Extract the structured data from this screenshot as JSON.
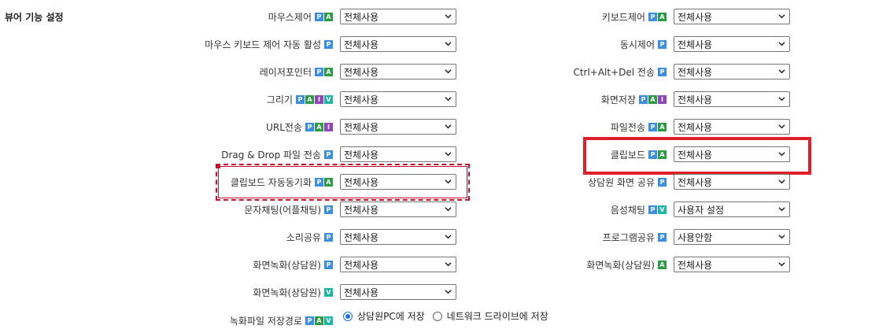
{
  "section_title": "뷰어 기능 설정",
  "left": [
    {
      "label": "마우스제어",
      "badges": [
        "P",
        "A"
      ],
      "value": "전체사용"
    },
    {
      "label": "마우스 키보드 제어 자동 활성",
      "badges": [
        "P"
      ],
      "value": "전체사용"
    },
    {
      "label": "레이저포인터",
      "badges": [
        "P",
        "A"
      ],
      "value": "전체사용"
    },
    {
      "label": "그리기",
      "badges": [
        "P",
        "A",
        "I",
        "V"
      ],
      "value": "전체사용"
    },
    {
      "label": "URL전송",
      "badges": [
        "P",
        "A",
        "I"
      ],
      "value": "전체사용"
    },
    {
      "label": "Drag & Drop 파일 전송",
      "badges": [
        "P"
      ],
      "value": "전체사용"
    },
    {
      "label": "클립보드 자동동기화",
      "badges": [
        "P",
        "A"
      ],
      "value": "전체사용"
    },
    {
      "label": "문자채팅(어플채팅)",
      "badges": [
        "P"
      ],
      "value": "전체사용"
    },
    {
      "label": "소리공유",
      "badges": [
        "P"
      ],
      "value": "전체사용"
    },
    {
      "label": "화면녹화(상담원)",
      "badges": [
        "P"
      ],
      "value": "전체사용"
    },
    {
      "label": "화면녹화(상담원)",
      "badges": [
        "V"
      ],
      "value": "전체사용"
    }
  ],
  "left_last": {
    "label": "녹화파일 저장경로",
    "badges": [
      "P",
      "A",
      "V"
    ],
    "options": [
      {
        "label": "상담원PC에 저장",
        "selected": true
      },
      {
        "label": "네트워크 드라이브에 저장",
        "selected": false
      }
    ]
  },
  "right": [
    {
      "label": "키보드제어",
      "badges": [
        "P",
        "A"
      ],
      "value": "전체사용"
    },
    {
      "label": "동시제어",
      "badges": [
        "P"
      ],
      "value": "전체사용"
    },
    {
      "label": "Ctrl+Alt+Del 전송",
      "badges": [
        "P"
      ],
      "value": "전체사용"
    },
    {
      "label": "화면저장",
      "badges": [
        "P",
        "A",
        "I"
      ],
      "value": "전체사용"
    },
    {
      "label": "파일전송",
      "badges": [
        "P",
        "A"
      ],
      "value": "전체사용"
    },
    {
      "label": "클립보드",
      "badges": [
        "P",
        "A"
      ],
      "value": "전체사용"
    },
    {
      "label": "상담원 화면 공유",
      "badges": [
        "P"
      ],
      "value": "전체사용"
    },
    {
      "label": "음성채팅",
      "badges": [
        "P",
        "V"
      ],
      "value": "사용자 설정"
    },
    {
      "label": "프로그램공유",
      "badges": [
        "P"
      ],
      "value": "사용안함"
    },
    {
      "label": "화면녹화(상담원)",
      "badges": [
        "A"
      ],
      "value": "전체사용"
    }
  ],
  "badge_colors": {
    "P": "#3c8fe0",
    "A": "#2f9a46",
    "I": "#8e47b8",
    "V": "#1fb5a3"
  },
  "icons": {
    "select": "chevron-down-icon",
    "radio": "radio-button"
  }
}
